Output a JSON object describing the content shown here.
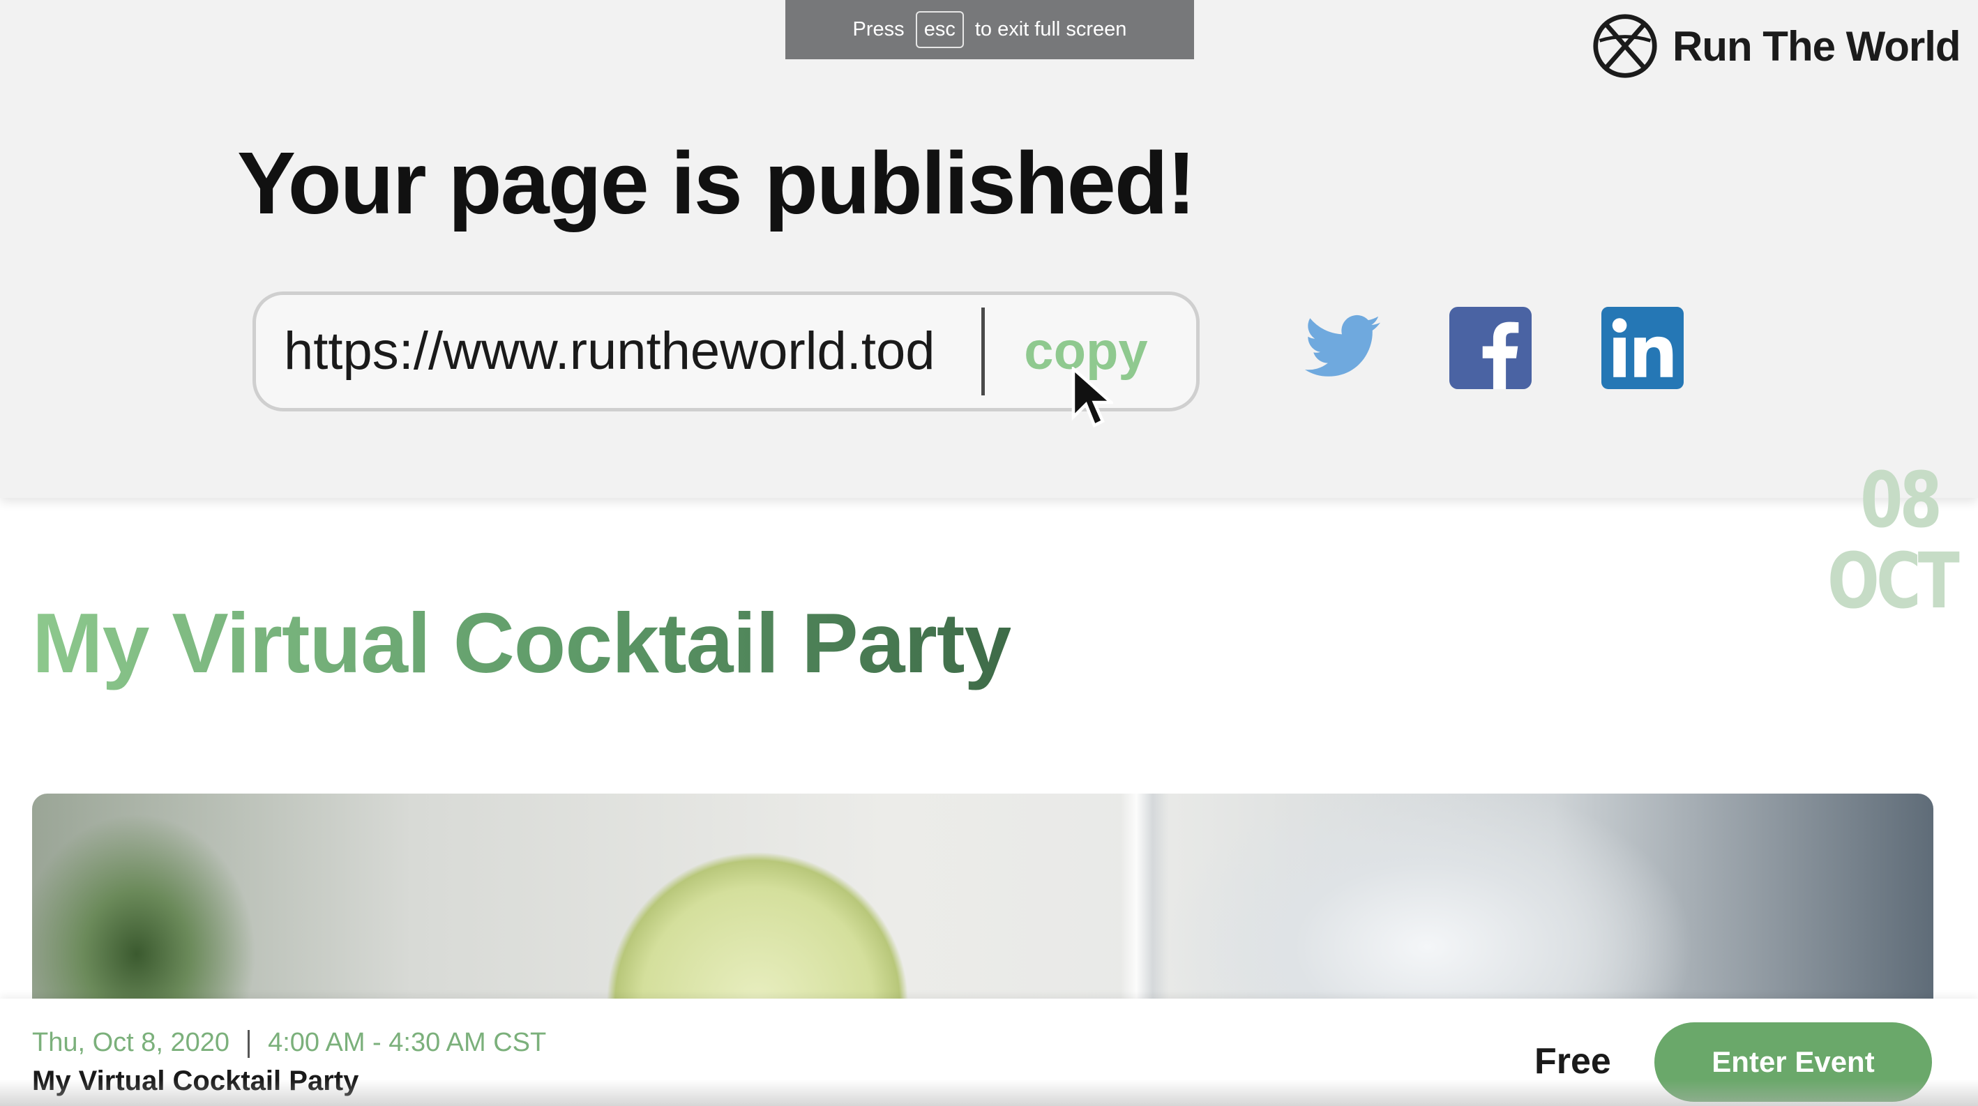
{
  "fullscreen_notice": {
    "press": "Press",
    "key": "esc",
    "rest": "to exit full screen"
  },
  "brand": {
    "name": "Run The World",
    "logo_icon": "globe-x-icon"
  },
  "publish": {
    "headline": "Your page is published!",
    "url_value": "https://www.runtheworld.tod",
    "copy_label": "copy",
    "share_icons": [
      "twitter-icon",
      "facebook-icon",
      "linkedin-icon"
    ]
  },
  "event": {
    "title": "My Virtual Cocktail Party",
    "date_day": "08",
    "date_month": "OCT",
    "date_line": "Thu, Oct 8, 2020",
    "time_line": "4:00 AM - 4:30 AM CST",
    "footer_name": "My Virtual Cocktail Party",
    "price": "Free",
    "enter_label": "Enter Event"
  },
  "colors": {
    "accent_green": "#6aa86a",
    "copy_green": "#8fc98f",
    "twitter": "#6fa9de",
    "facebook": "#4a63a3",
    "linkedin": "#2577b5"
  }
}
